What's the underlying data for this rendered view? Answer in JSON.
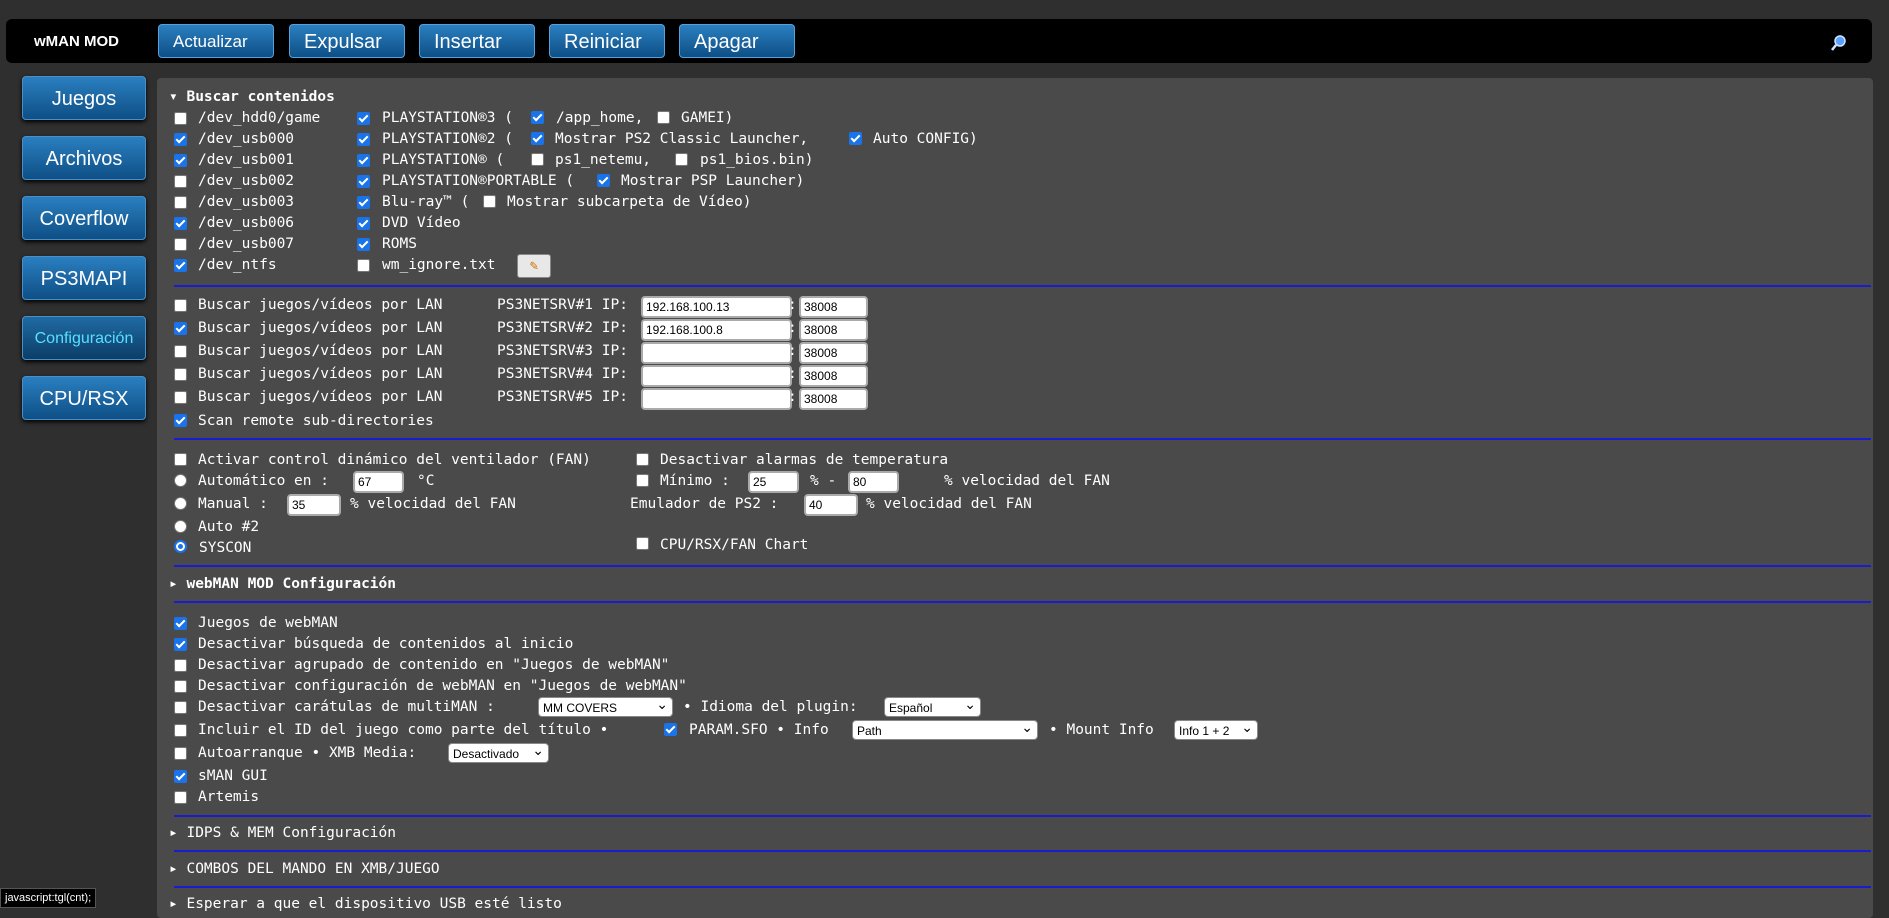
{
  "header": {
    "brand": "wMAN MOD",
    "buttons": [
      "Actualizar",
      "Expulsar",
      "Insertar",
      "Reiniciar",
      "Apagar"
    ]
  },
  "sidebar": [
    "Juegos",
    "Archivos",
    "Coverflow",
    "PS3MAPI",
    "Configuración",
    "CPU/RSX"
  ],
  "sections": {
    "buscar": "Buscar contenidos",
    "webman": "webMAN MOD Configuración",
    "idps": "IDPS & MEM Configuración",
    "combos": "COMBOS DEL MANDO EN XMB/JUEGO",
    "usb": "Esperar a que el dispositivo USB esté listo"
  },
  "devices": [
    {
      "label": "/dev_hdd0/game",
      "checked": false
    },
    {
      "label": "/dev_usb000",
      "checked": true
    },
    {
      "label": "/dev_usb001",
      "checked": true
    },
    {
      "label": "/dev_usb002",
      "checked": false
    },
    {
      "label": "/dev_usb003",
      "checked": false
    },
    {
      "label": "/dev_usb006",
      "checked": true
    },
    {
      "label": "/dev_usb007",
      "checked": false
    },
    {
      "label": "/dev_ntfs",
      "checked": true
    }
  ],
  "content": {
    "ps3": "PLAYSTATION®3 (",
    "app_home": "/app_home,",
    "gamei": "GAMEI)",
    "ps2": "PLAYSTATION®2 (",
    "ps2_launcher": "Mostrar PS2 Classic Launcher,",
    "auto_config": "Auto CONFIG)",
    "ps1": "PLAYSTATION®  (",
    "ps1_netemu": "ps1_netemu,",
    "ps1_bios": "ps1_bios.bin)",
    "psp": "PLAYSTATION®PORTABLE (",
    "psp_launcher": "Mostrar PSP Launcher)",
    "bluray": "Blu-ray™ (",
    "video_sub": "Mostrar subcarpeta de Vídeo)",
    "dvd": "DVD Vídeo",
    "roms": "ROMS",
    "ignore": "wm_ignore.txt"
  },
  "lan": {
    "label": "Buscar juegos/vídeos por LAN",
    "servers": [
      {
        "name": "PS3NETSRV#1 IP:",
        "ip": "192.168.100.13",
        "port": "38008",
        "checked": false
      },
      {
        "name": "PS3NETSRV#2 IP:",
        "ip": "192.168.100.8",
        "port": "38008",
        "checked": true
      },
      {
        "name": "PS3NETSRV#3 IP:",
        "ip": "",
        "port": "38008",
        "checked": false
      },
      {
        "name": "PS3NETSRV#4 IP:",
        "ip": "",
        "port": "38008",
        "checked": false
      },
      {
        "name": "PS3NETSRV#5 IP:",
        "ip": "",
        "port": "38008",
        "checked": false
      }
    ],
    "scan_remote": "Scan remote sub-directories"
  },
  "fan": {
    "dynamic": "Activar control dinámico del ventilador (FAN)",
    "disable_alarms": "Desactivar alarmas de temperatura",
    "auto": "Automático en :",
    "auto_val": "67",
    "celsius": "°C",
    "min": "Mínimo :",
    "min_val": "25",
    "dash": "% -",
    "max_val": "80",
    "pct_fan": "% velocidad del FAN",
    "manual": "Manual :",
    "manual_val": "35",
    "ps2emu": "Emulador de PS2 :",
    "ps2emu_val": "40",
    "auto2": "Auto #2",
    "syscon": "SYSCON",
    "chart": "CPU/RSX/FAN Chart"
  },
  "webman": {
    "juegos": "Juegos de webMAN",
    "no_search": "Desactivar búsqueda de contenidos al inicio",
    "no_group": "Desactivar agrupado de contenido en \"Juegos de webMAN\"",
    "no_config": "Desactivar configuración de webMAN en \"Juegos de webMAN\"",
    "no_covers": "Desactivar carátulas de multiMAN :",
    "covers_sel": "MM COVERS",
    "lang_label": "• Idioma del plugin:",
    "lang_sel": "Español",
    "incl_id": "Incluir el ID del juego como parte del título •",
    "param": "PARAM.SFO • Info",
    "info_sel": "Path",
    "mount_label": "• Mount Info",
    "mount_sel": "Info 1 + 2",
    "autostart": "Autoarranque • XMB Media:",
    "xmb_sel": "Desactivado",
    "sman": "sMAN GUI",
    "artemis": "Artemis"
  },
  "statusbar": "javascript:tgl(cnt);"
}
